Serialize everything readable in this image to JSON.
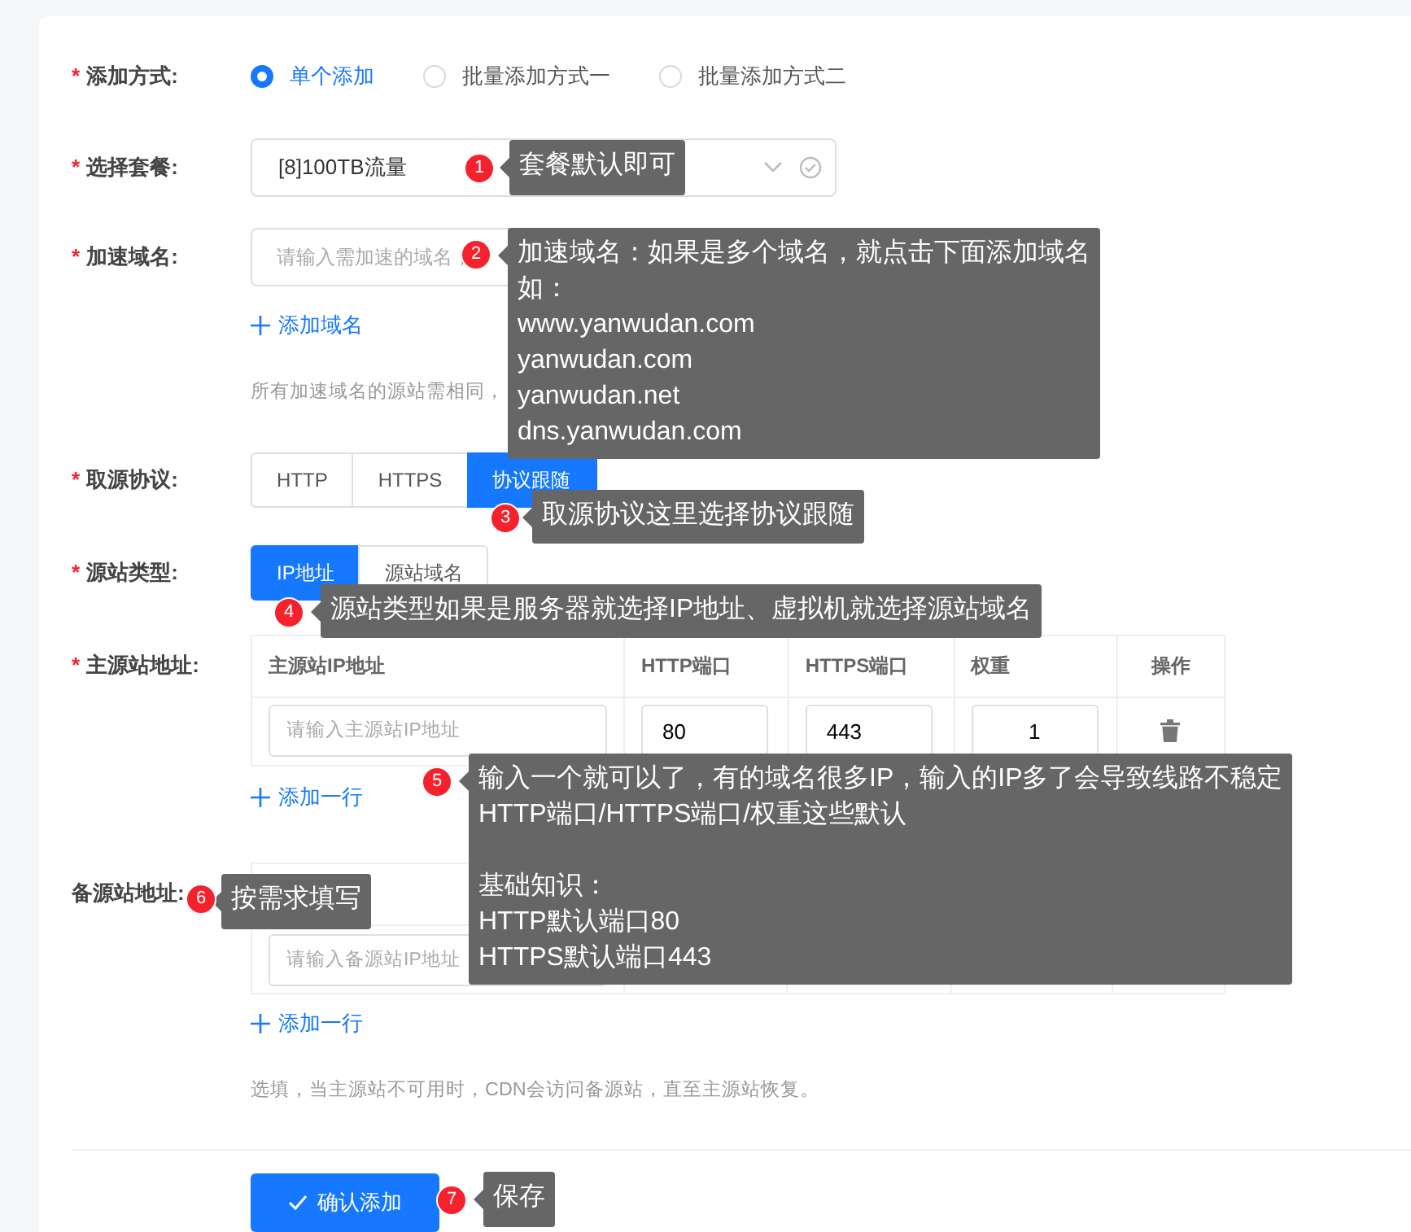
{
  "add_method": {
    "mark": "*",
    "label": "添加方式:",
    "options": [
      {
        "label": "单个添加",
        "selected": true
      },
      {
        "label": "批量添加方式一",
        "selected": false
      },
      {
        "label": "批量添加方式二",
        "selected": false
      }
    ]
  },
  "package": {
    "mark": "*",
    "label": "选择套餐:",
    "value": "[8]100TB流量"
  },
  "domain": {
    "mark": "*",
    "label": "加速域名:",
    "placeholder": "请输入需加速的域名，",
    "add_link": "添加域名",
    "hint": "所有加速域名的源站需相同，"
  },
  "protocol": {
    "mark": "*",
    "label": "取源协议:",
    "options": [
      {
        "label": "HTTP",
        "selected": false
      },
      {
        "label": "HTTPS",
        "selected": false
      },
      {
        "label": "协议跟随",
        "selected": true
      }
    ]
  },
  "origin_type": {
    "mark": "*",
    "label": "源站类型:",
    "options": [
      {
        "label": "IP地址",
        "selected": true
      },
      {
        "label": "源站域名",
        "selected": false
      }
    ]
  },
  "primary_origin": {
    "mark": "*",
    "label": "主源站地址:",
    "columns": [
      "主源站IP地址",
      "HTTP端口",
      "HTTPS端口",
      "权重",
      "操作"
    ],
    "rows": [
      {
        "ip_placeholder": "请输入主源站IP地址",
        "http_port": "80",
        "https_port": "443",
        "weight": "1"
      }
    ],
    "add_link": "添加一行"
  },
  "backup_origin": {
    "label": "备源站地址:",
    "rows": [
      {
        "ip_placeholder": "请输入备源站IP地址"
      }
    ],
    "add_link": "添加一行",
    "hint": "选填，当主源站不可用时，CDN会访问备源站，直至主源站恢复。"
  },
  "submit": "确认添加",
  "callouts": [
    {
      "number": "1",
      "paragraphs": [
        [
          "套餐默认即可"
        ]
      ]
    },
    {
      "number": "2",
      "paragraphs": [
        [
          "加速域名：如果是多个域名，就点击下面添加域名",
          "如：",
          "www.yanwudan.com",
          "yanwudan.com",
          "yanwudan.net",
          "dns.yanwudan.com"
        ]
      ]
    },
    {
      "number": "3",
      "paragraphs": [
        [
          "取源协议这里选择协议跟随"
        ]
      ]
    },
    {
      "number": "4",
      "paragraphs": [
        [
          "源站类型如果是服务器就选择IP地址、虚拟机就选择源站域名"
        ]
      ]
    },
    {
      "number": "5",
      "paragraphs": [
        [
          "输入一个就可以了，有的域名很多IP，输入的IP多了会导致线路不稳定",
          "HTTP端口/HTTPS端口/权重这些默认"
        ],
        [
          "基础知识：",
          "HTTP默认端口80",
          "HTTPS默认端口443"
        ]
      ]
    },
    {
      "number": "6",
      "paragraphs": [
        [
          "按需求填写"
        ]
      ]
    },
    {
      "number": "7",
      "paragraphs": [
        [
          "保存"
        ]
      ]
    }
  ]
}
